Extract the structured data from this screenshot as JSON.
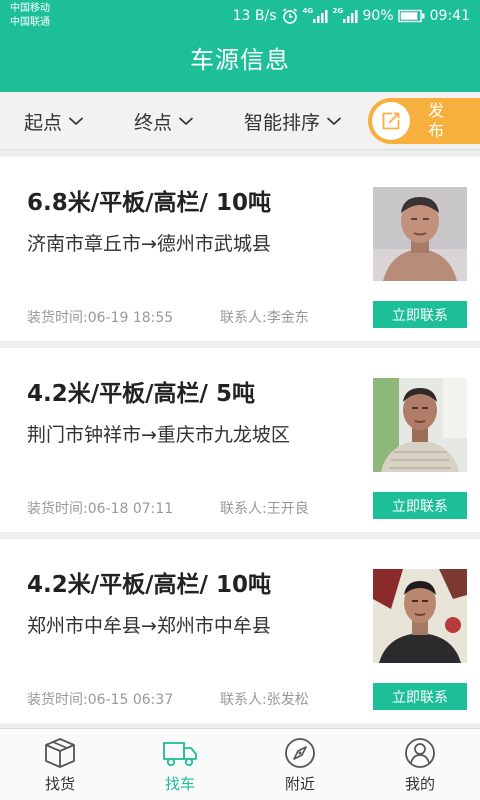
{
  "status_bar": {
    "carrier_1": "中国移动",
    "carrier_2": "中国联通",
    "network_speed": "13 B/s",
    "signal_1_label": "4G",
    "signal_2_label": "2G",
    "battery": "90%",
    "battery_level": 0.9,
    "time": "09:41"
  },
  "header": {
    "title": "车源信息"
  },
  "filters": {
    "start": "起点",
    "end": "终点",
    "sort": "智能排序",
    "publish": "发布"
  },
  "listings": [
    {
      "title": "6.8米/平板/高栏/ 10吨",
      "route": "济南市章丘市→德州市武城县",
      "load_time": "装货时间:06-19 18:55",
      "contact": "联系人:李金东",
      "button": "立即联系"
    },
    {
      "title": "4.2米/平板/高栏/ 5吨",
      "route": "荆门市钟祥市→重庆市九龙坡区",
      "load_time": "装货时间:06-18 07:11",
      "contact": "联系人:王开良",
      "button": "立即联系"
    },
    {
      "title": "4.2米/平板/高栏/ 10吨",
      "route": "郑州市中牟县→郑州市中牟县",
      "load_time": "装货时间:06-15 06:37",
      "contact": "联系人:张发松",
      "button": "立即联系"
    }
  ],
  "tabs": [
    {
      "label": "找货",
      "icon": "package-icon"
    },
    {
      "label": "找车",
      "icon": "truck-icon"
    },
    {
      "label": "附近",
      "icon": "compass-icon"
    },
    {
      "label": "我的",
      "icon": "user-icon"
    }
  ],
  "colors": {
    "brand": "#1dbf98",
    "publish": "#f7b03d"
  }
}
